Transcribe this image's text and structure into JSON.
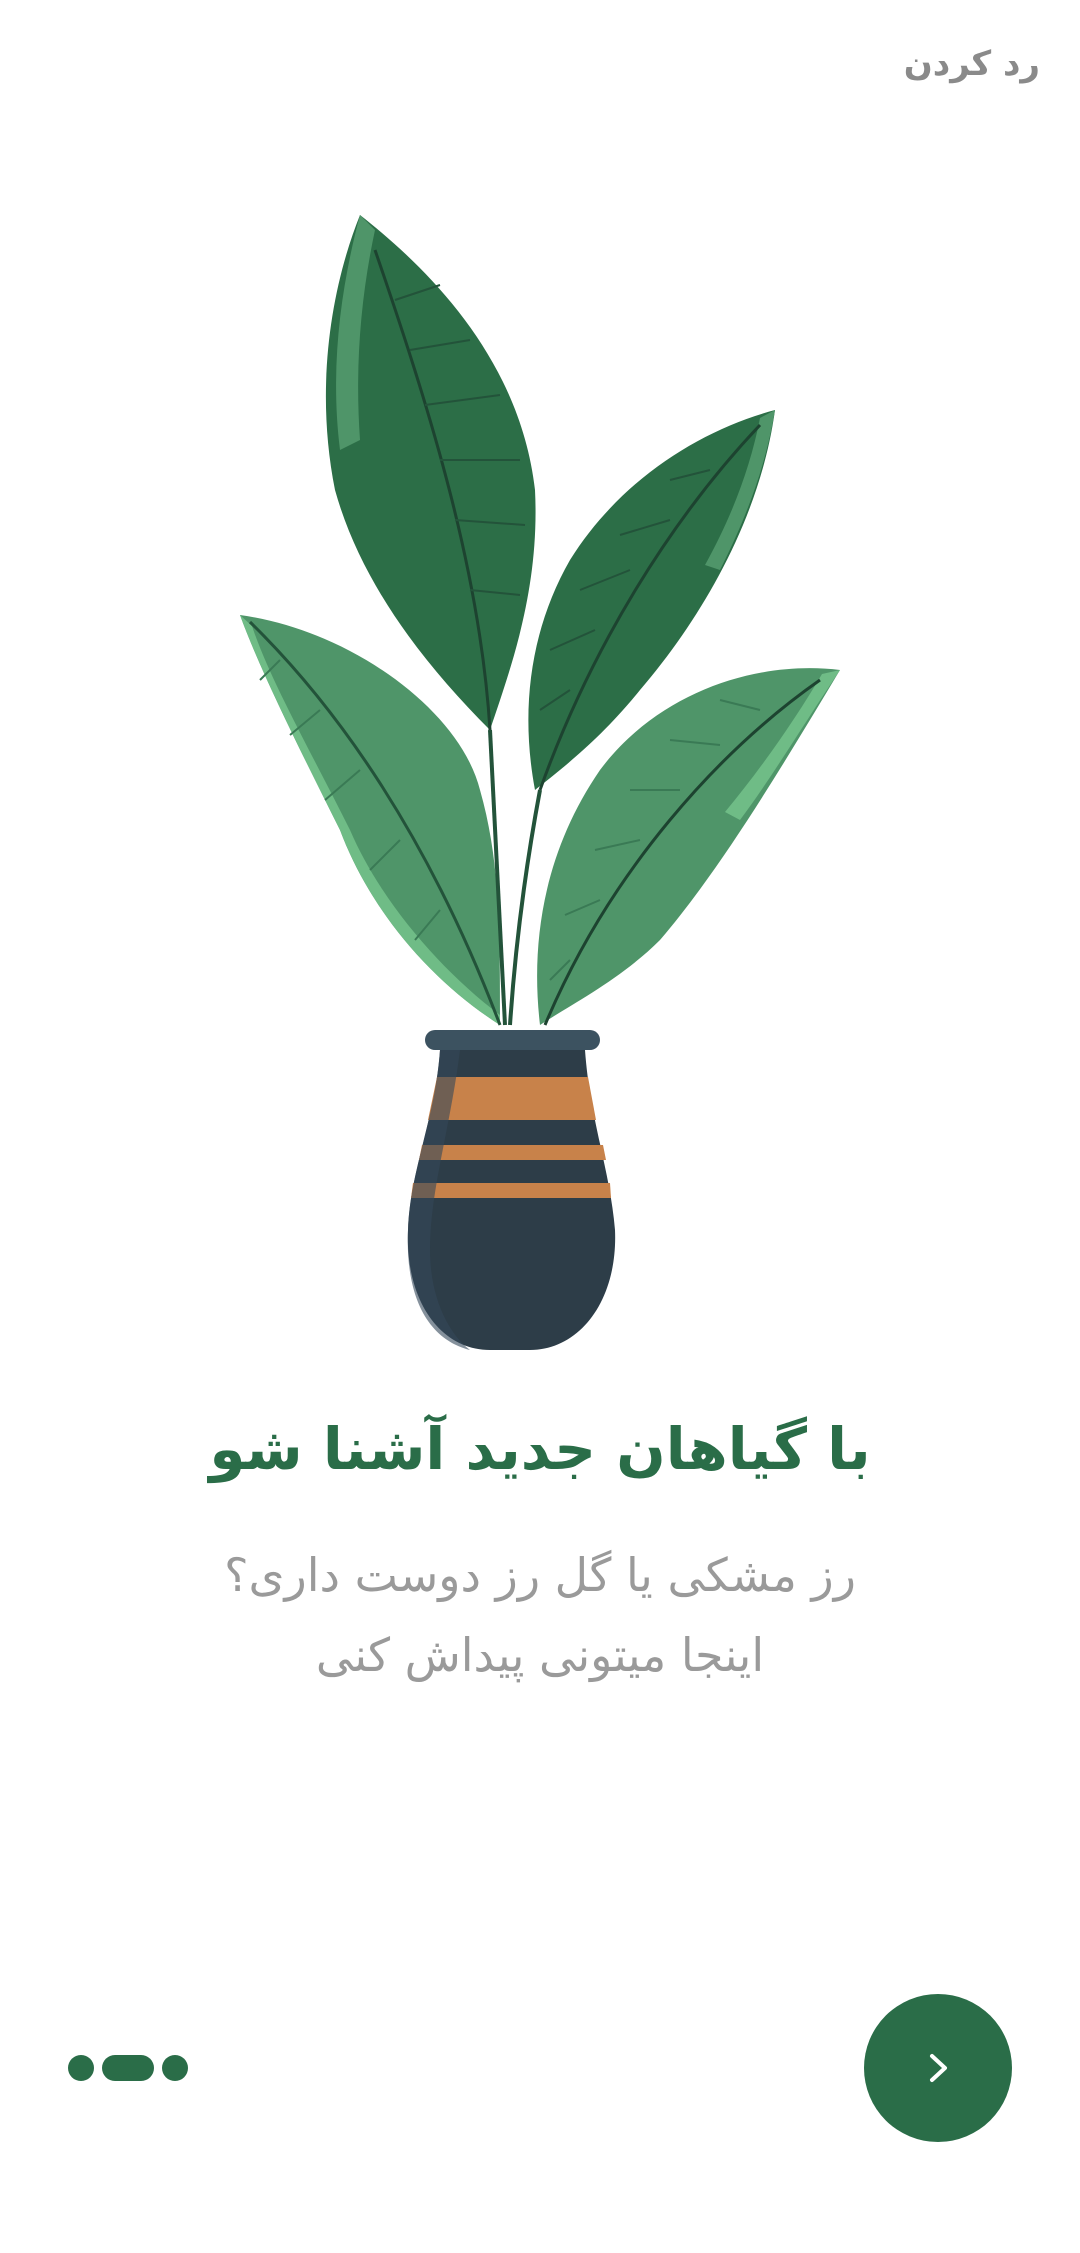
{
  "header": {
    "skip_label": "رد کردن"
  },
  "onboarding": {
    "title": "با گیاهان جدید آشنا شو",
    "subtitle_line1": "رز مشکی یا گل رز دوست داری؟",
    "subtitle_line2": "اینجا میتونی پیداش کنی"
  },
  "pager": {
    "total": 3,
    "active_index": 1
  },
  "next_button": {
    "icon": "chevron-right-icon"
  },
  "colors": {
    "primary": "#2a6d48",
    "text_muted": "#9a9a9a",
    "skip_text": "#8a8a8a",
    "background": "#ffffff"
  }
}
